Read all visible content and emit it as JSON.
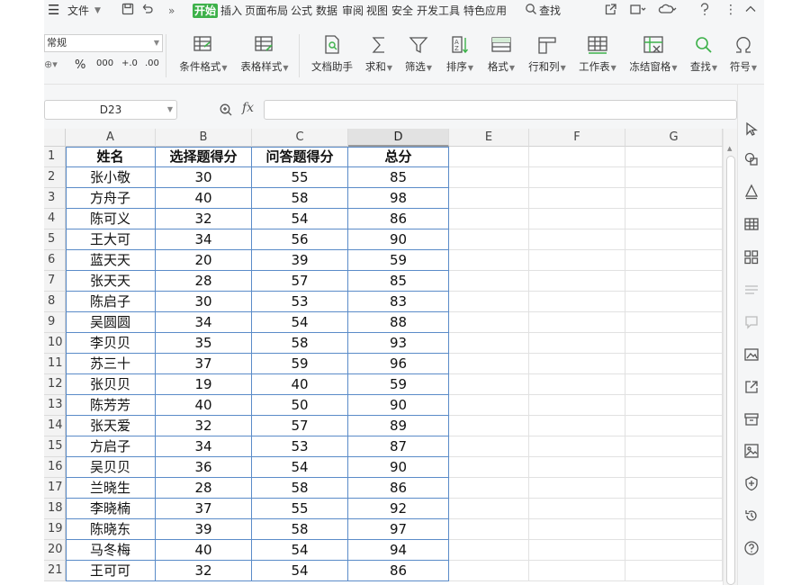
{
  "menu": {
    "file": "文件",
    "tabs": [
      "开始",
      "插入",
      "页面布局",
      "公式",
      "数据",
      "审阅",
      "视图",
      "安全",
      "开发工具",
      "特色应用"
    ],
    "active_tab": "开始",
    "search": "查找"
  },
  "ribbon": {
    "number_format": "常规",
    "number_buttons": [
      "%",
      "000",
      "+.0",
      ".00"
    ],
    "buttons": {
      "conditional_format": "条件格式",
      "table_style": "表格样式",
      "doc_helper": "文档助手",
      "sum": "求和",
      "filter": "筛选",
      "sort": "排序",
      "format": "格式",
      "row_col": "行和列",
      "worksheet": "工作表",
      "freeze": "冻结窗格",
      "find": "查找",
      "symbol": "符号"
    }
  },
  "formula_bar": {
    "name_box": "D23",
    "fx": "fx",
    "formula": ""
  },
  "grid": {
    "columns": [
      "A",
      "B",
      "C",
      "D",
      "E",
      "F",
      "G"
    ],
    "selected_column": "D",
    "header": [
      "姓名",
      "选择题得分",
      "问答题得分",
      "总分"
    ],
    "rows": [
      [
        "张小敬",
        "30",
        "55",
        "85"
      ],
      [
        "方舟子",
        "40",
        "58",
        "98"
      ],
      [
        "陈可义",
        "32",
        "54",
        "86"
      ],
      [
        "王大可",
        "34",
        "56",
        "90"
      ],
      [
        "蓝天天",
        "20",
        "39",
        "59"
      ],
      [
        "张天天",
        "28",
        "57",
        "85"
      ],
      [
        "陈启子",
        "30",
        "53",
        "83"
      ],
      [
        "吴圆圆",
        "34",
        "54",
        "88"
      ],
      [
        "李贝贝",
        "35",
        "58",
        "93"
      ],
      [
        "苏三十",
        "37",
        "59",
        "96"
      ],
      [
        "张贝贝",
        "19",
        "40",
        "59"
      ],
      [
        "陈芳芳",
        "40",
        "50",
        "90"
      ],
      [
        "张天爱",
        "32",
        "57",
        "89"
      ],
      [
        "方启子",
        "34",
        "53",
        "87"
      ],
      [
        "吴贝贝",
        "36",
        "54",
        "90"
      ],
      [
        "兰晓生",
        "28",
        "58",
        "86"
      ],
      [
        "李晓楠",
        "37",
        "55",
        "92"
      ],
      [
        "陈晓东",
        "39",
        "58",
        "97"
      ],
      [
        "马冬梅",
        "40",
        "54",
        "94"
      ],
      [
        "王可可",
        "32",
        "54",
        "86"
      ]
    ]
  },
  "side_icons": [
    "cursor-icon",
    "shapes-icon",
    "style-icon",
    "table-icon",
    "apps-icon",
    "filter-settings-icon",
    "comment-icon",
    "image-panel-icon",
    "share-icon",
    "archive-icon",
    "picture-icon",
    "shield-icon",
    "history-icon",
    "help-icon"
  ],
  "colors": {
    "accent": "#3db14a",
    "table_border": "#5a8bc8"
  }
}
